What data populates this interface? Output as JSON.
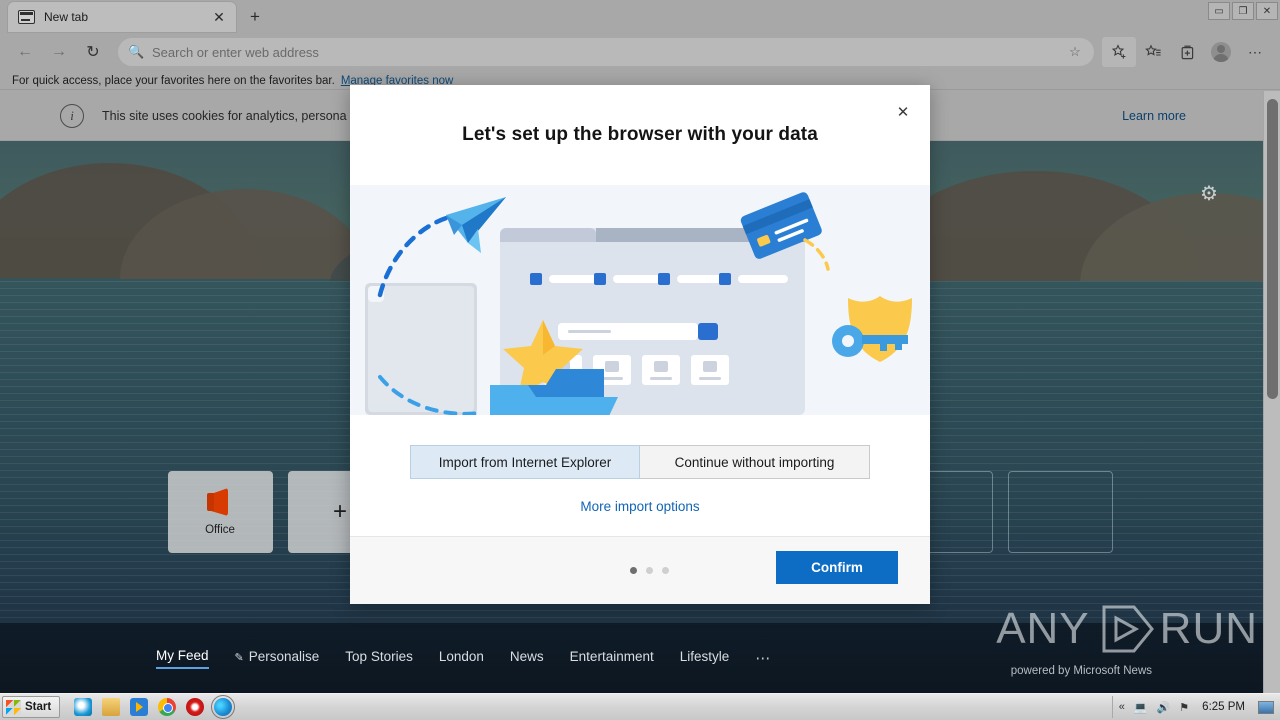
{
  "window": {
    "minimize_label": "▭",
    "maximize_label": "❐",
    "close_label": "✕"
  },
  "tab": {
    "title": "New tab",
    "close_label": "✕",
    "newtab_label": "+",
    "favicon_name": "newtab-favicon"
  },
  "toolbar": {
    "back_label": "←",
    "forward_label": "→",
    "refresh_label": "↻",
    "search_icon": "search-icon",
    "address_placeholder": "Search or enter web address",
    "address_value": "",
    "star_label": "☆",
    "favorites_label": "☆",
    "collections_label": "▣",
    "profile_label": "",
    "settings_label": "⋯"
  },
  "favorites_bar": {
    "message": "For quick access, place your favorites here on the favorites bar.",
    "link": "Manage favorites now"
  },
  "cookie_bar": {
    "info_icon": "i",
    "text": "This site uses cookies for analytics, persona",
    "learn_more": "Learn more"
  },
  "newtab_page": {
    "gear_label": "⚙",
    "tiles": [
      {
        "label": "Office",
        "icon": "office-icon",
        "type": "site"
      },
      {
        "label": "+",
        "icon": "plus-icon",
        "type": "add"
      },
      {
        "label": "",
        "icon": "",
        "type": "empty"
      },
      {
        "label": "",
        "icon": "",
        "type": "empty"
      },
      {
        "label": "",
        "icon": "",
        "type": "empty"
      },
      {
        "label": "",
        "icon": "",
        "type": "empty"
      },
      {
        "label": "",
        "icon": "",
        "type": "empty"
      },
      {
        "label": "",
        "icon": "",
        "type": "empty"
      }
    ],
    "news_nav": [
      {
        "label": "My Feed",
        "active": true,
        "pen": false
      },
      {
        "label": "Personalise",
        "active": false,
        "pen": true
      },
      {
        "label": "Top Stories",
        "active": false,
        "pen": false
      },
      {
        "label": "London",
        "active": false,
        "pen": false
      },
      {
        "label": "News",
        "active": false,
        "pen": false
      },
      {
        "label": "Entertainment",
        "active": false,
        "pen": false
      },
      {
        "label": "Lifestyle",
        "active": false,
        "pen": false
      }
    ],
    "news_more": "⋯",
    "powered_by": "powered by Microsoft News"
  },
  "watermark": {
    "left_text": "ANY",
    "right_text": "RUN"
  },
  "dialog": {
    "title": "Let's set up the browser with your data",
    "close_label": "✕",
    "import_button": "Import from Internet Explorer",
    "continue_button": "Continue without importing",
    "more_options": "More import options",
    "confirm_button": "Confirm",
    "page_dots": [
      true,
      false,
      false
    ],
    "illustration_name": "setup-data-illustration"
  },
  "taskbar": {
    "start_label": "Start",
    "quick_launch": [
      "internet-explorer-icon",
      "folder-icon",
      "media-player-icon",
      "chrome-icon",
      "opera-icon",
      "edge-icon"
    ],
    "tray": {
      "overflow": "«",
      "network_icon": "network-icon",
      "volume_icon": "volume-icon",
      "flag_icon": "flag-icon",
      "time": "6:25 PM",
      "show_desktop": "show-desktop-icon"
    }
  },
  "colors": {
    "accent": "#0d6cc4",
    "link": "#1265b5",
    "selected_seg": "#ddeaf6"
  }
}
